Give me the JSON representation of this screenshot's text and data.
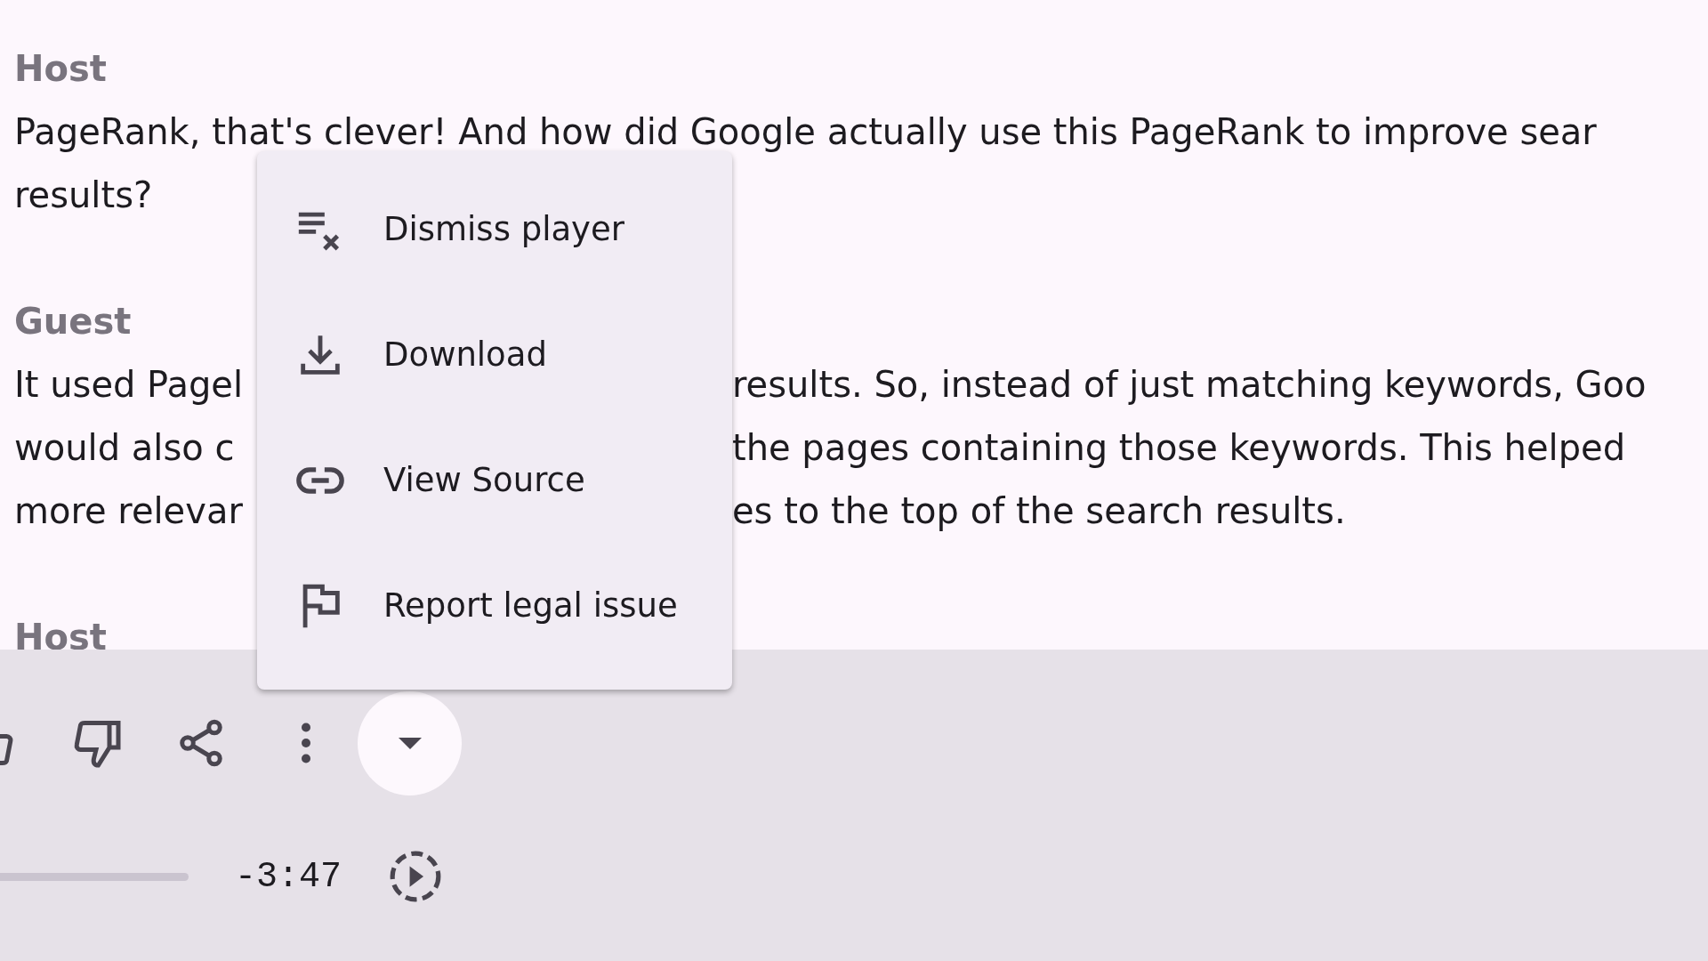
{
  "transcript": [
    {
      "speaker": "Host",
      "lines": [
        {
          "left": "PageRank, that's clever! And how did Google actually use this PageRank to improve sear"
        },
        {
          "left": "results?"
        }
      ]
    },
    {
      "speaker": "Guest",
      "lines": [
        {
          "left": "It used Pagel",
          "right": "results. So, instead of just matching keywords, Goo"
        },
        {
          "left": "would also c",
          "right": "the pages containing those keywords. This helped"
        },
        {
          "left": "more relevar",
          "right": "es to the top of the search results."
        }
      ]
    },
    {
      "speaker": "Host"
    }
  ],
  "menu": {
    "items": [
      {
        "kind": "dismiss",
        "label": "Dismiss player"
      },
      {
        "kind": "download",
        "label": "Download"
      },
      {
        "kind": "link",
        "label": "View Source"
      },
      {
        "kind": "flag",
        "label": "Report legal issue"
      }
    ]
  },
  "player": {
    "time": "-3:47"
  }
}
